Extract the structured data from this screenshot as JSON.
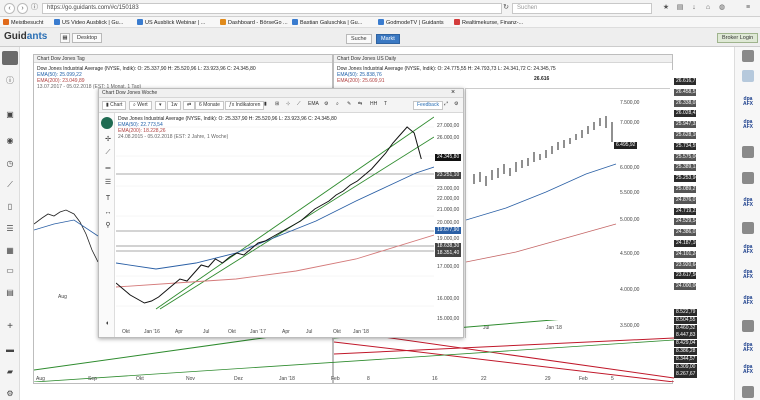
{
  "browser": {
    "url": "https://go.guidants.com/#c/150183",
    "search_placeholder": "Suchen",
    "bookmarks": [
      {
        "label": "Meistbesucht",
        "color": "#e06a1b"
      },
      {
        "label": "US Video Ausblick | Gu...",
        "color": "#3a7ccf"
      },
      {
        "label": "US Ausblick Webinar | ...",
        "color": "#3a7ccf"
      },
      {
        "label": "Dashboard - BörseGo ...",
        "color": "#e08a1b"
      },
      {
        "label": "Bastian Galuschka | Gu...",
        "color": "#3a7ccf"
      },
      {
        "label": "GodmodeTV | Guidants",
        "color": "#3a7ccf"
      },
      {
        "label": "Realtimekurse, Finanz-...",
        "color": "#d33c3c"
      }
    ]
  },
  "app": {
    "logo_main": "Guid",
    "logo_accent": "ants",
    "tab_desktop": "Desktop",
    "btn_suche": "Suche",
    "btn_markt": "Markt",
    "btn_broker": "Broker Login"
  },
  "chart_tag": {
    "title": "Chart Dow Jones Tag",
    "legend": [
      "Dow Jones Industrial Average (NYSE, Indik): O: 25.337,90 H: 25.520,96 L: 23.923,96 C: 24.345,80",
      "EMA(50): 25.099,22",
      "EMA(200): 23.049,89",
      "13.07.2017 - 05.02.2018 (EST: 1 Monat, 1 Tag)"
    ],
    "xticks": [
      "Aug",
      "Sep",
      "Okt",
      "Nov",
      "Dez",
      "Jan '18",
      "Feb"
    ]
  },
  "chart_us_daily": {
    "title": "Chart Dow Jones US Daily",
    "legend": [
      "Dow Jones Industrial Average (NYSE, Indik): O: 24.775,55 H: 24.793,73 L: 24.341,72 C: 24.345,75",
      "EMA(50): 25.838,76",
      "EMA(200): 25.609,91"
    ],
    "last_high_label": "26.616",
    "xticks": [
      "Jul",
      "Jan '18"
    ],
    "yticks": [
      "7.500,00",
      "7.000,00",
      "6.500,00",
      "6.000,00",
      "5.500,00",
      "5.000,00",
      "4.500,00",
      "4.000,00",
      "3.500,00"
    ],
    "price_marker": "6.495,92"
  },
  "chart_woche": {
    "title": "Chart Dow Jones Woche",
    "toolbar": {
      "chart": "Chart",
      "wert": "Wert",
      "interval": "1w",
      "range": "6 Monate",
      "indicators": "Indikatoren",
      "feedback": "Feedback"
    },
    "legend": [
      "Dow Jones Industrial Average (NYSE, Indik): O: 25.337,90 H: 25.520,96 L: 23.923,96 C: 24.345,80",
      "EMA(50): 22.773,54",
      "EMA(200): 18.228,26",
      "24.08.2015 - 05.02.2018 (EST: 2 Jahre, 1 Woche)"
    ],
    "xticks": [
      "Okt",
      "Jan '16",
      "Apr",
      "Jul",
      "Okt",
      "Jan '17",
      "Apr",
      "Jul",
      "Okt",
      "Jan '18"
    ],
    "yticks": [
      "27.000,00",
      "26.000,00",
      "25.000,00",
      "23.000,00",
      "22.000,00",
      "21.000,00",
      "20.000,00",
      "19.000,00",
      "18.000,00",
      "17.000,00",
      "16.000,00",
      "15.000,00"
    ],
    "tags": {
      "last": "24.345,80",
      "ema50": "22.773,54",
      "level1": "23.251,10",
      "level2": "19.677,90",
      "level3": "18.638,30",
      "level4": "18.351,40"
    }
  },
  "right_levels": [
    "26.616,71",
    "26.458,53",
    "26.338,03",
    "26.028,42",
    "25.947,32",
    "25.628,10",
    "25.734,59",
    "25.575,06",
    "25.389,13",
    "25.253,96",
    "25.089,27",
    "24.876,07",
    "24.719,22",
    "24.529,54",
    "24.386,03",
    "24.187,10",
    "24.101,24",
    "23.920,64",
    "23.617,50",
    "24.000,00"
  ],
  "bottom_levels": [
    "8.522,79",
    "8.504,55",
    "8.460,32",
    "8.447,83",
    "8.429,04",
    "8.386,28",
    "8.344,57",
    "8.309,00",
    "8.267,67"
  ],
  "bottom_xticks": [
    "Aug",
    "Sep",
    "Okt",
    "Nov",
    "Dez",
    "Jan '18",
    "Feb",
    "8",
    "16",
    "22",
    "29",
    "Feb",
    "5"
  ]
}
